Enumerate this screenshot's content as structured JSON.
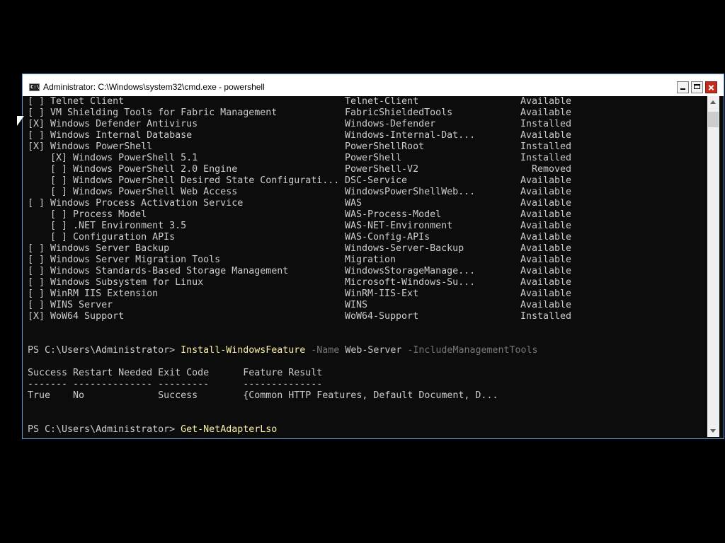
{
  "window": {
    "title": "Administrator: C:\\Windows\\system32\\cmd.exe - powershell",
    "icon": "C:\\"
  },
  "features": [
    {
      "display": "[ ] Telnet Client",
      "name": "Telnet-Client",
      "state": "Available"
    },
    {
      "display": "[ ] VM Shielding Tools for Fabric Management",
      "name": "FabricShieldedTools",
      "state": "Available"
    },
    {
      "display": "[X] Windows Defender Antivirus",
      "name": "Windows-Defender",
      "state": "Installed"
    },
    {
      "display": "[ ] Windows Internal Database",
      "name": "Windows-Internal-Dat...",
      "state": "Available"
    },
    {
      "display": "[X] Windows PowerShell",
      "name": "PowerShellRoot",
      "state": "Installed"
    },
    {
      "display": "    [X] Windows PowerShell 5.1",
      "name": "PowerShell",
      "state": "Installed"
    },
    {
      "display": "    [ ] Windows PowerShell 2.0 Engine",
      "name": "PowerShell-V2",
      "state": "  Removed"
    },
    {
      "display": "    [ ] Windows PowerShell Desired State Configurati...",
      "name": "DSC-Service",
      "state": "Available"
    },
    {
      "display": "    [ ] Windows PowerShell Web Access",
      "name": "WindowsPowerShellWeb...",
      "state": "Available"
    },
    {
      "display": "[ ] Windows Process Activation Service",
      "name": "WAS",
      "state": "Available"
    },
    {
      "display": "    [ ] Process Model",
      "name": "WAS-Process-Model",
      "state": "Available"
    },
    {
      "display": "    [ ] .NET Environment 3.5",
      "name": "WAS-NET-Environment",
      "state": "Available"
    },
    {
      "display": "    [ ] Configuration APIs",
      "name": "WAS-Config-APIs",
      "state": "Available"
    },
    {
      "display": "[ ] Windows Server Backup",
      "name": "Windows-Server-Backup",
      "state": "Available"
    },
    {
      "display": "[ ] Windows Server Migration Tools",
      "name": "Migration",
      "state": "Available"
    },
    {
      "display": "[ ] Windows Standards-Based Storage Management",
      "name": "WindowsStorageManage...",
      "state": "Available"
    },
    {
      "display": "[ ] Windows Subsystem for Linux",
      "name": "Microsoft-Windows-Su...",
      "state": "Available"
    },
    {
      "display": "[ ] WinRM IIS Extension",
      "name": "WinRM-IIS-Ext",
      "state": "Available"
    },
    {
      "display": "[ ] WINS Server",
      "name": "WINS",
      "state": "Available"
    },
    {
      "display": "[X] WoW64 Support",
      "name": "WoW64-Support",
      "state": "Installed"
    }
  ],
  "install_command": {
    "prompt": "PS C:\\Users\\Administrator> ",
    "cmdlet": "Install-WindowsFeature",
    "param1": " -Name",
    "value1": " Web-Server",
    "param2": " -IncludeManagementTools"
  },
  "result_table": {
    "header": "Success Restart Needed Exit Code      Feature Result",
    "separator": "------- -------------- ---------      --------------",
    "row": "True    No             Success        {Common HTTP Features, Default Document, D..."
  },
  "current_command": {
    "prompt": "PS C:\\Users\\Administrator> ",
    "cmdlet": "Get-NetAdapterLso"
  },
  "colors": {
    "console_bg": "#0c0c0c",
    "text": "#cccccc",
    "cmdlet": "#f9f1a5",
    "parameter": "#767676"
  }
}
